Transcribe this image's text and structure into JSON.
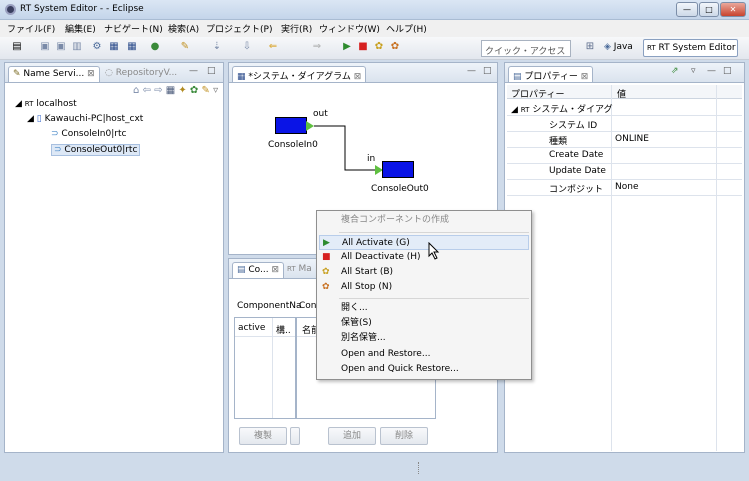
{
  "window": {
    "title": "RT System Editor - - Eclipse",
    "min": "—",
    "max": "□",
    "close": "✕"
  },
  "menubar": [
    "ファイル(F)",
    "編集(E)",
    "ナビゲート(N)",
    "検索(A)",
    "プロジェクト(P)",
    "実行(R)",
    "ウィンドウ(W)",
    "ヘルプ(H)"
  ],
  "toolbar": {
    "quick_access": "クイック・アクセス",
    "perspective_java": "Java",
    "perspective_rt": "RT System Editor"
  },
  "name_service": {
    "tab": "Name Servi...",
    "tab2": "RepositoryV...",
    "tree": {
      "root": "localhost",
      "host": "Kawauchi-PC|host_cxt",
      "items": [
        "ConsoleIn0|rtc",
        "ConsoleOut0|rtc"
      ]
    }
  },
  "diagram": {
    "tab": "*システム・ダイアグラム",
    "components": [
      {
        "name": "ConsoleIn0",
        "port": "out"
      },
      {
        "name": "ConsoleOut0",
        "port": "in"
      }
    ]
  },
  "bottom_panel": {
    "tab1": "Co...",
    "tab2": "Ma",
    "label": "ComponentNa",
    "label2": "Cont",
    "col_active": "active",
    "col_kou": "構..",
    "col_name": "名前",
    "btn_copy": "複製",
    "btn_add": "追加",
    "btn_delete": "削除"
  },
  "context_menu": {
    "header": "複合コンポーネントの作成",
    "items": [
      {
        "label": "All Activate (G)",
        "icon": "activate-icon",
        "color": "#2e8b2e"
      },
      {
        "label": "All Deactivate (H)",
        "icon": "deactivate-icon",
        "color": "#d62020"
      },
      {
        "label": "All Start (B)",
        "icon": "start-icon",
        "color": "#c8a020"
      },
      {
        "label": "All Stop (N)",
        "icon": "stop-icon",
        "color": "#c87020"
      }
    ],
    "items2": [
      "開く...",
      "保管(S)",
      "別名保管...",
      "Open and Restore...",
      "Open and Quick Restore..."
    ]
  },
  "properties": {
    "tab": "プロパティー",
    "col_prop": "プロパティー",
    "col_value": "値",
    "category": "システム・ダイアグ",
    "rows": [
      {
        "name": "システム ID",
        "value": ""
      },
      {
        "name": "種類",
        "value": "ONLINE"
      },
      {
        "name": "Create Date",
        "value": ""
      },
      {
        "name": "Update Date",
        "value": ""
      },
      {
        "name": "コンポジット",
        "value": "None"
      }
    ]
  },
  "colors": {
    "component": "#0a14e6",
    "port": "#5fc040"
  }
}
